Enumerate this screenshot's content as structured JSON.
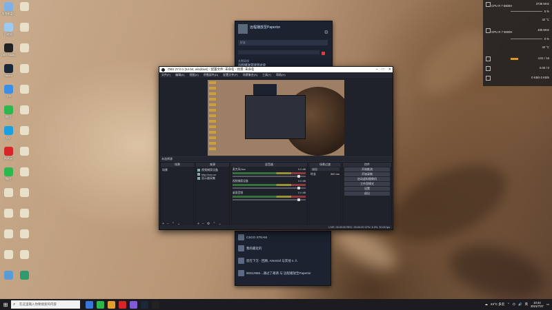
{
  "desktop_icons": [
    {
      "label": "本地磁盘C",
      "color": "#7fb0e6"
    },
    {
      "label": "",
      "color": "#e8e0c8"
    },
    {
      "label": "回收站",
      "color": "#9ec9f0"
    },
    {
      "label": "",
      "color": "#e8e0c8"
    },
    {
      "label": "OBS Studio",
      "color": "#222222"
    },
    {
      "label": "",
      "color": "#e8e0c8"
    },
    {
      "label": "Steam",
      "color": "#1b2838"
    },
    {
      "label": "",
      "color": "#e8e0c8"
    },
    {
      "label": "飞书",
      "color": "#3d8ee6"
    },
    {
      "label": "",
      "color": "#e8e0c8"
    },
    {
      "label": "微信",
      "color": "#2db84d"
    },
    {
      "label": "",
      "color": "#e8e0c8"
    },
    {
      "label": "QQ",
      "color": "#1aa0e0"
    },
    {
      "label": "",
      "color": "#e8e0c8"
    },
    {
      "label": "网易云",
      "color": "#d6262a"
    },
    {
      "label": "",
      "color": "#e8e0c8"
    },
    {
      "label": "微信",
      "color": "#2db84d"
    },
    {
      "label": "",
      "color": "#e8e0c8"
    },
    {
      "label": "",
      "color": "#e8e0c8"
    },
    {
      "label": "",
      "color": "#e8e0c8"
    },
    {
      "label": "",
      "color": "#e8e0c8"
    },
    {
      "label": "",
      "color": "#e8e0c8"
    },
    {
      "label": "",
      "color": "#e8e0c8"
    },
    {
      "label": "",
      "color": "#e8e0c8"
    },
    {
      "label": "",
      "color": "#e8e0c8"
    },
    {
      "label": "",
      "color": "#e8e0c8"
    },
    {
      "label": "",
      "color": "#5a9cd8"
    },
    {
      "label": "",
      "color": "#2e9a6e"
    }
  ],
  "steam_top": {
    "name": "远程播放至Papertor",
    "bar_text": "好友",
    "section": "长期离线",
    "item": "远程播放游戏到此处"
  },
  "steam_bottom": {
    "rows": [
      "CSGO STEAM",
      "我的最近的",
      "您在下方 - 回顾, Artemisf 与其他 4 人",
      "90312965…通过了邀请 与 远程播放至Papertor"
    ]
  },
  "obs": {
    "title": "OBS 27.0.1 (64-bit, windows) - 配置文件: 未命名 - 场景: 未命名",
    "menu": [
      "文件(F)",
      "编辑(E)",
      "视图(V)",
      "停靠部件(D)",
      "配置文件(P)",
      "场景集合(S)",
      "工具(T)",
      "帮助(H)"
    ],
    "dock_label": "未选择源",
    "scenes": {
      "title": "场景",
      "items": [
        "场景"
      ]
    },
    "sources": {
      "title": "来源",
      "items": [
        "视频捕获设备",
        "http://xxx.cn",
        "显示器采集"
      ]
    },
    "mixer": {
      "title": "混音器",
      "channels": [
        {
          "name": "麦克风/Aux",
          "db": "0.0 dB"
        },
        {
          "name": "视频捕获设备",
          "db": "0.0 dB"
        },
        {
          "name": "桌面音频",
          "db": "0.0 dB"
        }
      ]
    },
    "transitions": {
      "title": "场景过渡",
      "type": "淡出",
      "duration_label": "时长",
      "duration": "300 ms"
    },
    "controls": {
      "title": "控件",
      "buttons": [
        "开始推流",
        "开始录制",
        "启动虚拟摄像机",
        "工作室模式",
        "设置",
        "退出"
      ]
    },
    "status": "LIVE: 00:00:00   REC: 00:00:00   CPU: 6.3%, 30.00 fps"
  },
  "perf": {
    "cpu_label": "CPU",
    "cpu_model": "R 7 5800H",
    "cpu_freq": "3736 MHz",
    "cpu_pct": "5 %",
    "cpu_temp": "42 °C",
    "gpu_label": "GPU",
    "gpu_model": "R 7 5800H",
    "gpu_freq": "400 MHz",
    "gpu_pct": "0 %",
    "gpu_temp": "42 °C",
    "mem": "4.51 / 16",
    "disk": "0.00 / 0",
    "net": "0 KB/s   0 KB/s",
    "mem_fraction": 0.28
  },
  "taskbar": {
    "search_placeholder": "在这里输入你要搜索的内容",
    "weather": "24°C 多云",
    "lang": "英",
    "time": "10:44",
    "date": "2021/7/27",
    "icon_colors": [
      "#3a76d8",
      "#2db84d",
      "#e0a030",
      "#d6262a",
      "#7f5cd6",
      "#1b2838",
      "#222222"
    ]
  }
}
